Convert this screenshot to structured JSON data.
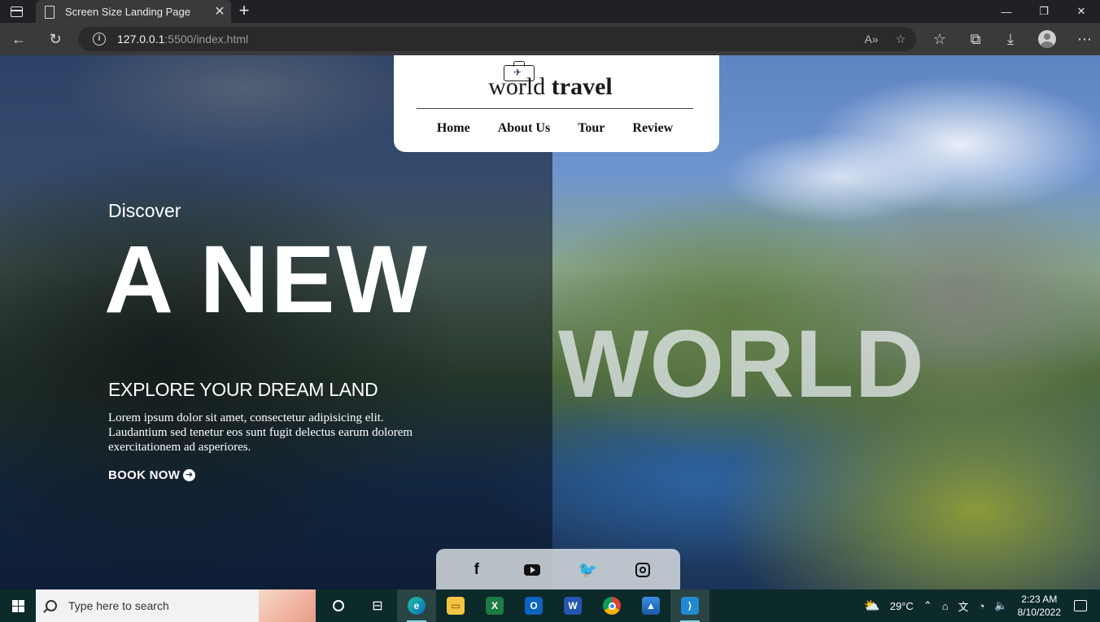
{
  "browser": {
    "tab_title": "Screen Size Landing Page",
    "tab_close": "✕",
    "new_tab": "+",
    "url_host": "127.0.0.1",
    "url_rest": ":5500/index.html",
    "window_controls": {
      "minimize": "—",
      "restore": "❐",
      "close": "✕"
    }
  },
  "brand": {
    "name_light": "world",
    "name_bold": "travel"
  },
  "nav": {
    "items": [
      "Home",
      "About Us",
      "Tour",
      "Review"
    ]
  },
  "hero": {
    "eyebrow": "Discover",
    "headline_left": "A NEW",
    "headline_right": "WORLD",
    "subtitle": "EXPLORE YOUR DREAM LAND",
    "body": "Lorem ipsum dolor sit amet, consectetur adipisicing elit. Laudantium sed tenetur eos sunt fugit delectus earum dolorem exercitationem ad asperiores.",
    "cta": "BOOK NOW"
  },
  "social": {
    "icons": [
      "facebook-icon",
      "youtube-icon",
      "twitter-icon",
      "instagram-icon"
    ]
  },
  "taskbar": {
    "search_placeholder": "Type here to search",
    "weather": "29°C",
    "time": "2:23 AM",
    "date": "8/10/2022"
  },
  "colors": {
    "page_overlay": "#060c1c",
    "card": "#ffffff",
    "taskbar": "#0d2a2a"
  }
}
